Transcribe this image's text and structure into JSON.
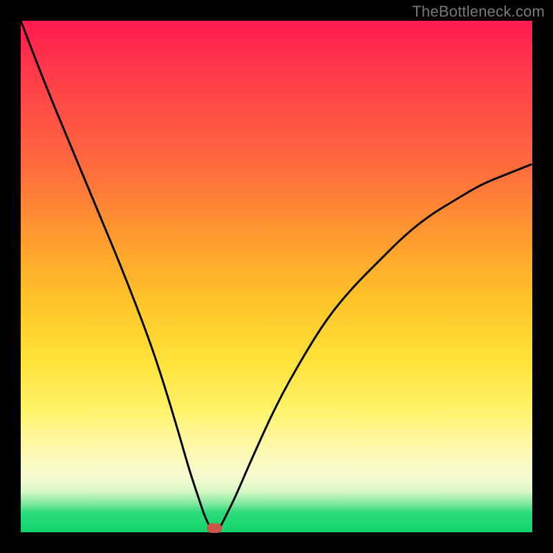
{
  "watermark": "TheBottleneck.com",
  "colors": {
    "frame": "#000000",
    "curve": "#000000",
    "marker": "#c9564a",
    "gradient_top": "#ff1a4f",
    "gradient_bottom": "#11d46a"
  },
  "chart_data": {
    "type": "line",
    "title": "",
    "xlabel": "",
    "ylabel": "",
    "xlim": [
      0,
      100
    ],
    "ylim": [
      0,
      100
    ],
    "x": [
      0,
      5,
      10,
      15,
      20,
      25,
      28,
      31,
      33,
      35,
      36,
      37,
      37.5,
      38,
      39,
      40,
      42,
      45,
      50,
      55,
      60,
      65,
      70,
      75,
      80,
      85,
      90,
      95,
      100
    ],
    "values": [
      100,
      87,
      75,
      63,
      51,
      38,
      29,
      19,
      12,
      6,
      3,
      1,
      0,
      0,
      1,
      3,
      7,
      14,
      25,
      34,
      42,
      48,
      53,
      58,
      62,
      65,
      68,
      70,
      72
    ],
    "marker": {
      "x": 37.8,
      "y": 0
    },
    "annotations": []
  }
}
